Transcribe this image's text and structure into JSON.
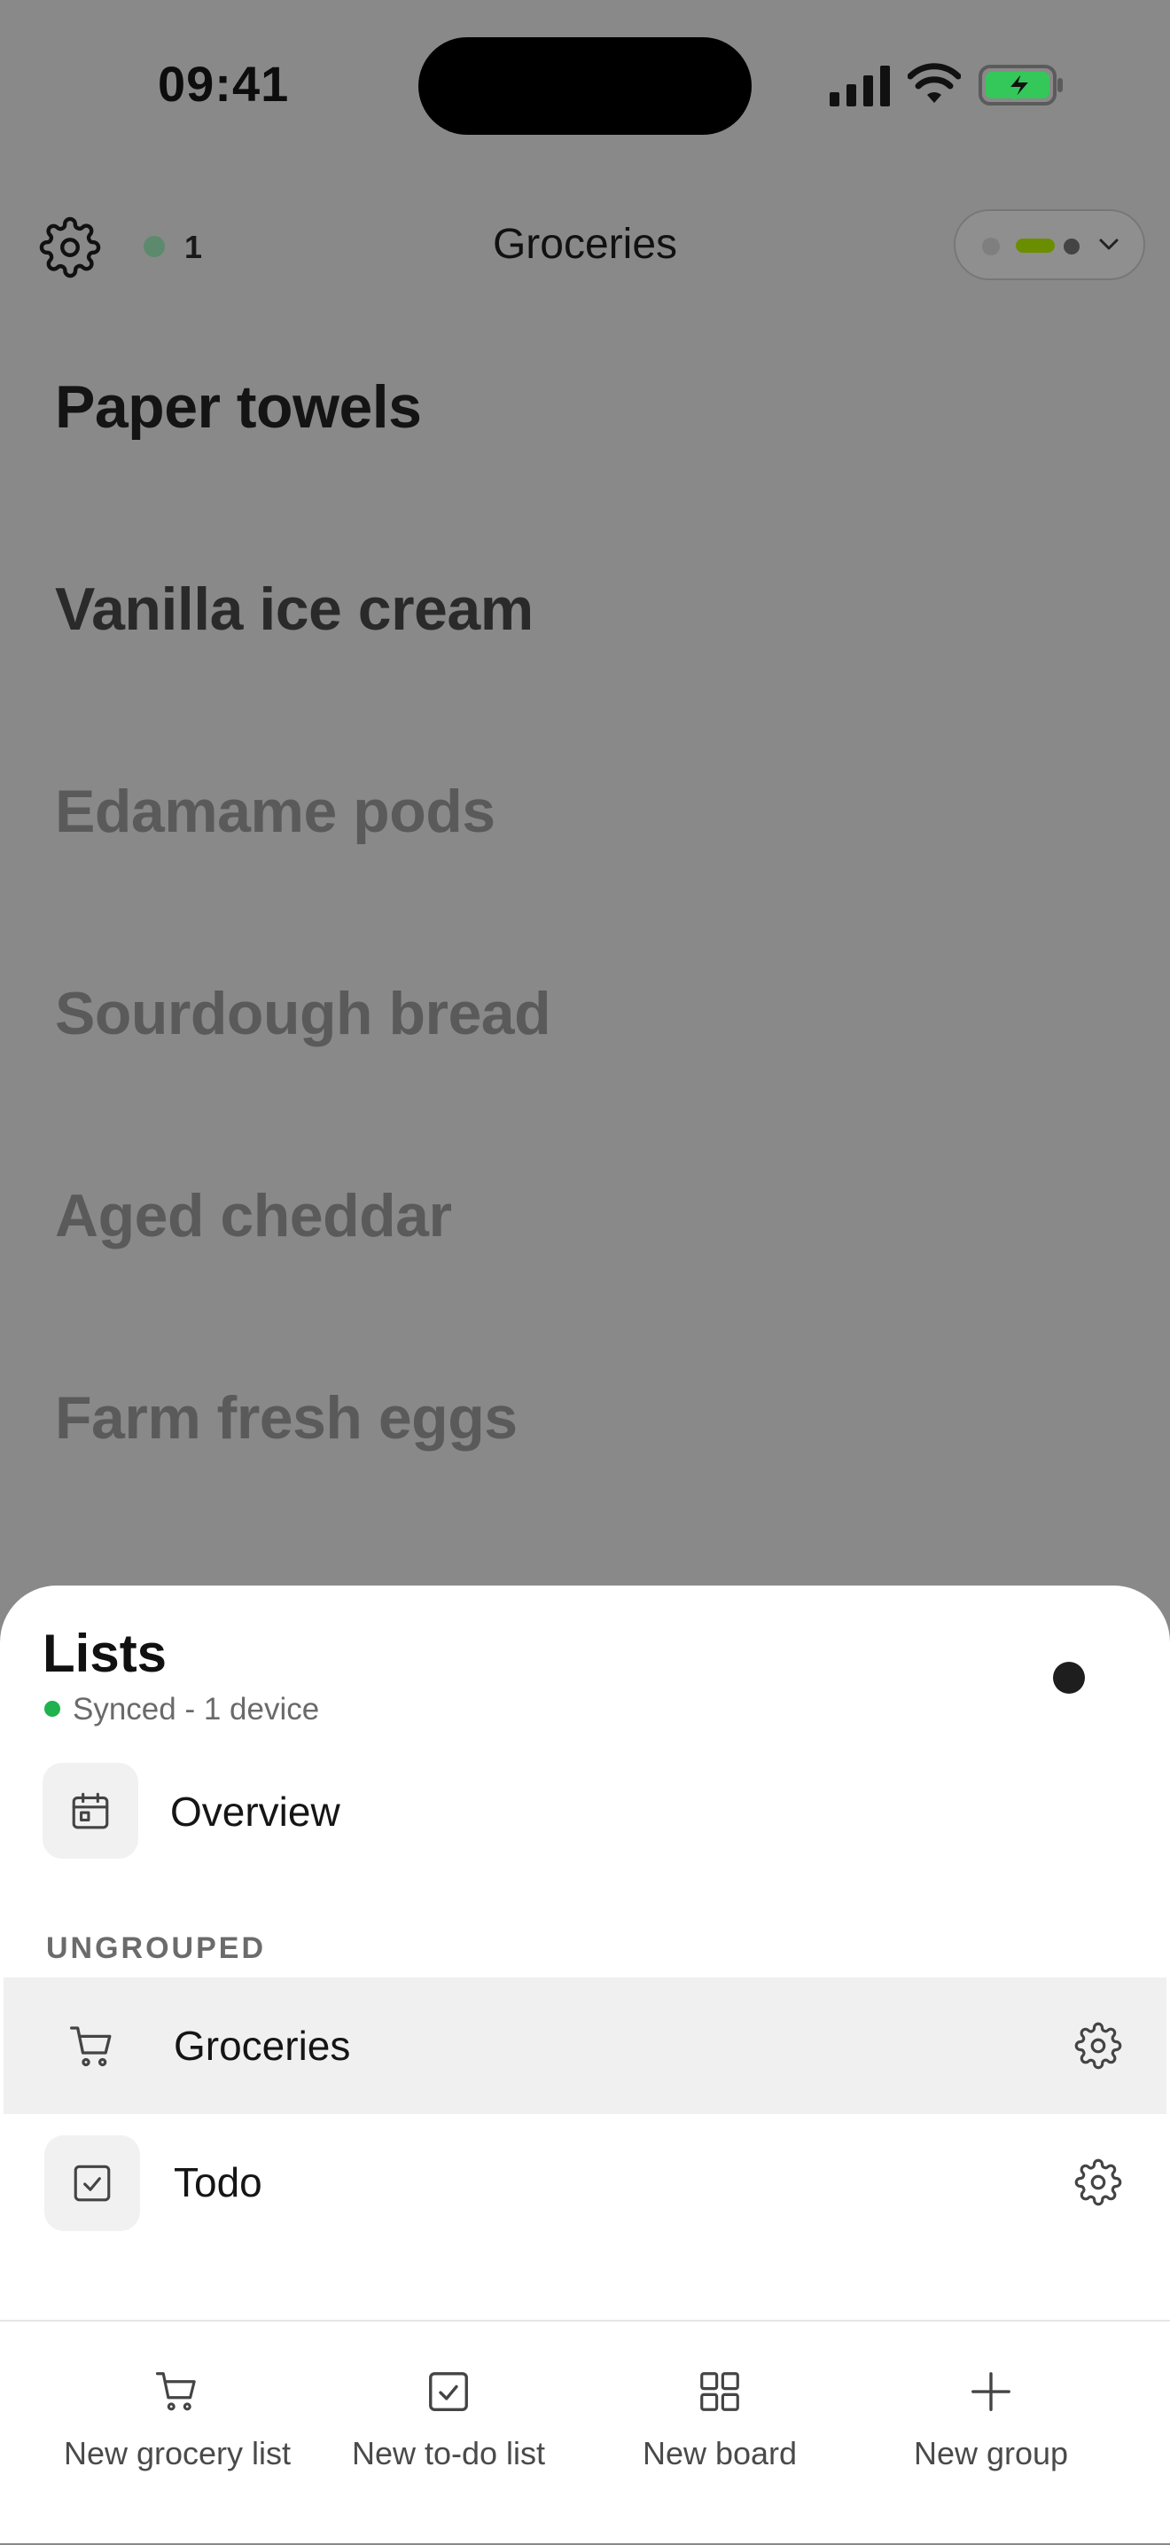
{
  "status_bar": {
    "time": "09:41"
  },
  "header": {
    "title": "Groceries",
    "count": "1"
  },
  "items": [
    {
      "label": "Paper towels"
    },
    {
      "label": "Vanilla ice cream"
    },
    {
      "label": "Edamame pods"
    },
    {
      "label": "Sourdough bread"
    },
    {
      "label": "Aged cheddar"
    },
    {
      "label": "Farm fresh eggs"
    }
  ],
  "sheet": {
    "title": "Lists",
    "sync_status": "Synced - 1 device",
    "overview_label": "Overview",
    "section_label": "UNGROUPED",
    "lists": [
      {
        "label": "Groceries",
        "icon": "cart-icon",
        "active": true
      },
      {
        "label": "Todo",
        "icon": "checkbox-icon",
        "active": false
      }
    ]
  },
  "toolbar": {
    "new_grocery_list": "New grocery list",
    "new_todo_list": "New to-do list",
    "new_board": "New board",
    "new_group": "New group"
  },
  "colors": {
    "backdrop": "#898989",
    "sync_green": "#1fb24d",
    "active_row": "#f0f0f0",
    "pill_accent": "#6b8e00"
  }
}
